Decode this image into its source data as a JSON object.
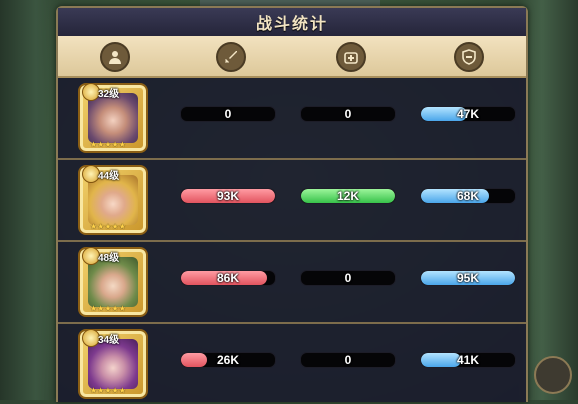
{
  "title": "战斗统计",
  "columns": [
    {
      "icon": "person-icon"
    },
    {
      "icon": "sword-icon"
    },
    {
      "icon": "heal-icon"
    },
    {
      "icon": "shield-icon"
    }
  ],
  "colors": {
    "damage": "#e2545f",
    "heal": "#37c24a",
    "defense": "#4aa6ea"
  },
  "rows": [
    {
      "level": "32级",
      "stars": "★★★★★",
      "damage": {
        "text": "0",
        "fill": 0
      },
      "heal": {
        "text": "0",
        "fill": 0
      },
      "defense": {
        "text": "47K",
        "fill": 0.49
      }
    },
    {
      "level": "44级",
      "stars": "★★★★★",
      "damage": {
        "text": "93K",
        "fill": 1.0
      },
      "heal": {
        "text": "12K",
        "fill": 1.0
      },
      "defense": {
        "text": "68K",
        "fill": 0.72
      }
    },
    {
      "level": "48级",
      "stars": "★★★★★",
      "damage": {
        "text": "86K",
        "fill": 0.92
      },
      "heal": {
        "text": "0",
        "fill": 0
      },
      "defense": {
        "text": "95K",
        "fill": 1.0
      }
    },
    {
      "level": "34级",
      "stars": "★★★★★",
      "damage": {
        "text": "26K",
        "fill": 0.28
      },
      "heal": {
        "text": "0",
        "fill": 0
      },
      "defense": {
        "text": "41K",
        "fill": 0.43
      }
    }
  ]
}
